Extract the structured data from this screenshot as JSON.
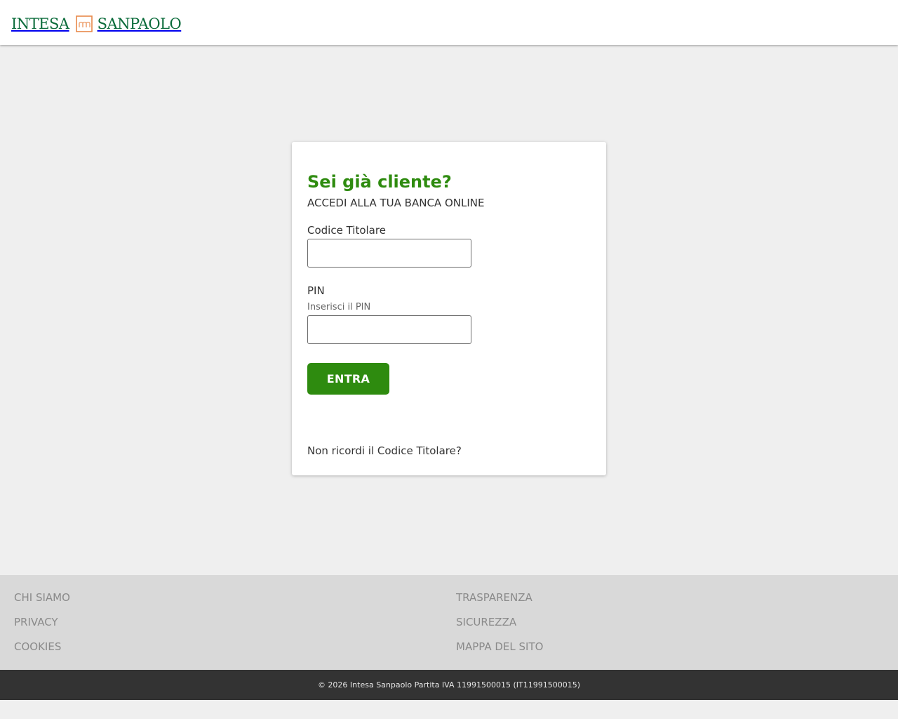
{
  "header": {
    "logo_left": "INTESA",
    "logo_right": "SANPAOLO",
    "logo_mark_icon": "intesa-sanpaolo-bridge-icon"
  },
  "login": {
    "title": "Sei già cliente?",
    "subtitle": "ACCEDI ALLA TUA BANCA ONLINE",
    "code_label": "Codice Titolare",
    "code_value": "",
    "pin_label": "PIN",
    "pin_hint": "Inserisci il PIN",
    "pin_value": "",
    "submit_label": "ENTRA",
    "forgot_link": "Non ricordi il Codice Titolare?"
  },
  "footer": {
    "links_left": [
      "CHI SIAMO",
      "PRIVACY",
      "COOKIES"
    ],
    "links_right": [
      "TRASPARENZA",
      "SICUREZZA",
      "MAPPA DEL SITO"
    ],
    "copyright": "© 2026 Intesa Sanpaolo Partita IVA 11991500015 (IT11991500015)"
  },
  "colors": {
    "brand_green": "#0a6b3a",
    "accent_green": "#2e8b0f",
    "logo_orange": "#e8894a",
    "page_background": "#efefef",
    "footer_background": "#d9d9d9",
    "footer_bottom_background": "#333333"
  }
}
